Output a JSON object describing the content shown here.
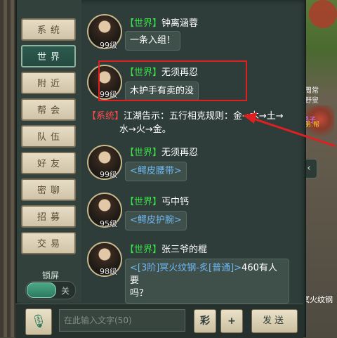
{
  "tabs": [
    {
      "label": "系统",
      "active": false
    },
    {
      "label": "世界",
      "active": true
    },
    {
      "label": "附近",
      "active": false
    },
    {
      "label": "帮会",
      "active": false
    },
    {
      "label": "队伍",
      "active": false
    },
    {
      "label": "好友",
      "active": false
    },
    {
      "label": "密聊",
      "active": false
    },
    {
      "label": "招募",
      "active": false
    },
    {
      "label": "交易",
      "active": false
    }
  ],
  "lock": {
    "label": "锁屏",
    "state": "关"
  },
  "messages": [
    {
      "channel": "【世界】",
      "name": "钟离涵蓉",
      "level": "99级",
      "text": "一条入组！"
    },
    {
      "channel": "【世界】",
      "name": "无须再忍",
      "level": "99级",
      "text": "木护手有卖的没"
    },
    {
      "channel": "【系统】",
      "text_line1": "江湖告示：五行相克规则：金→木→土→",
      "text_line2": "水→火→金。"
    },
    {
      "channel": "【世界】",
      "name": "无须再忍",
      "level": "99级",
      "link": "<鳄皮腰带>"
    },
    {
      "channel": "【世界】",
      "name": "丐中钙",
      "level": "95级",
      "link": "<鳄皮护腕>"
    },
    {
      "channel": "【世界】",
      "name": "张三爷的棍",
      "level": "98级",
      "link": "<[3阶]冥火纹钢-炙[普通]>",
      "text_after": "460有人要",
      "text_line2": "吗？"
    }
  ],
  "input": {
    "placeholder": "在此输入文字(50)"
  },
  "buttons": {
    "color": "彩",
    "plus": "+",
    "send": "发送"
  },
  "scene": {
    "name1": "周常",
    "name2": "野叟",
    "name3": "鹤子",
    "name4": "弟:帮",
    "bottom_text": "冥火纹钢"
  },
  "colors": {
    "world_channel": "#3be04a",
    "system_channel": "#ff4b4b",
    "item_link": "#6fb7f2",
    "annotation": "#e02020"
  }
}
